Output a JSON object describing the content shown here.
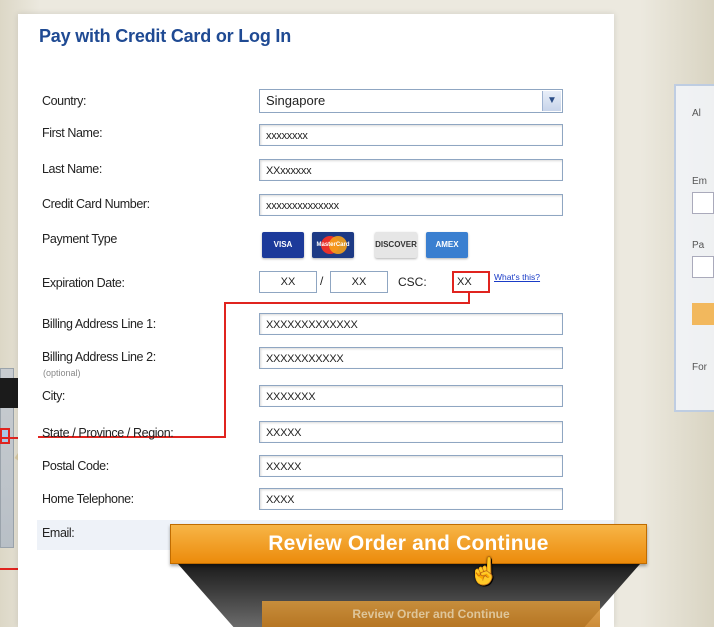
{
  "page": {
    "title": "Pay with Credit Card or Log In"
  },
  "form": {
    "country": {
      "label": "Country:",
      "value": "Singapore"
    },
    "first_name": {
      "label": "First Name:",
      "value": "xxxxxxxx"
    },
    "last_name": {
      "label": "Last Name:",
      "value": "XXxxxxxx"
    },
    "card_number": {
      "label": "Credit Card Number:",
      "value": "xxxxxxxxxxxxxx"
    },
    "payment_type": {
      "label": "Payment Type",
      "cards": [
        "VISA",
        "MasterCard",
        "DISCOVER",
        "AMEX"
      ]
    },
    "expiration": {
      "label": "Expiration Date:",
      "month": "XX",
      "slash": "/",
      "year": "XX",
      "csc_label": "CSC:",
      "csc_value": "XX",
      "whats_this": "What's this?"
    },
    "billing1": {
      "label": "Billing Address Line 1:",
      "value": "XXXXXXXXXXXXX"
    },
    "billing2": {
      "label": "Billing Address Line 2:",
      "sub_label": "(optional)",
      "value": "XXXXXXXXXXX"
    },
    "city": {
      "label": "City:",
      "value": "XXXXXXX"
    },
    "state": {
      "label": "State / Province / Region:",
      "value": "XXXXX"
    },
    "postal": {
      "label": "Postal Code:",
      "value": "XXXXX"
    },
    "phone": {
      "label": "Home Telephone:",
      "value": "XXXX"
    },
    "email": {
      "label": "Email:"
    }
  },
  "review_button": {
    "label": "Review Order and Continue"
  },
  "review_button_small": {
    "label": "Review Order and Continue"
  },
  "login_panel": {
    "title": "Al",
    "email_label": "Em",
    "password_label": "Pa",
    "footer": "For"
  },
  "colors": {
    "title": "#1f4a93",
    "accent": "#ec8b0b",
    "highlight": "#e0241f"
  }
}
